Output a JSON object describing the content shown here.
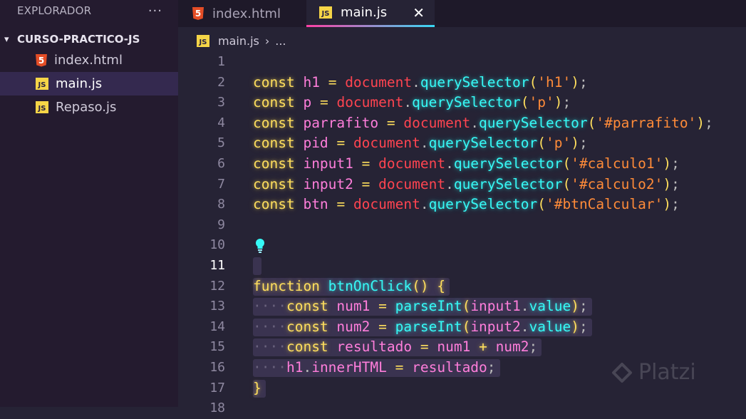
{
  "sidebar": {
    "title": "EXPLORADOR",
    "more": "···",
    "folder": "CURSO-PRACTICO-JS",
    "files": [
      {
        "name": "index.html",
        "icon": "html-file-icon"
      },
      {
        "name": "main.js",
        "icon": "js-file-icon",
        "active": true
      },
      {
        "name": "Repaso.js",
        "icon": "js-file-icon"
      }
    ]
  },
  "tabs": [
    {
      "label": "index.html",
      "icon": "html-file-icon"
    },
    {
      "label": "main.js",
      "icon": "js-file-icon",
      "active": true,
      "close": "✕"
    }
  ],
  "breadcrumb": {
    "file": "main.js",
    "sep": "›",
    "rest": "..."
  },
  "icons": {
    "html": "5",
    "js": "JS"
  },
  "editor": {
    "current_line": 11,
    "lines": [
      {
        "n": "1",
        "tokens": []
      },
      {
        "n": "2",
        "tokens": [
          [
            "k",
            "const"
          ],
          [
            "w",
            " "
          ],
          [
            "v",
            "h1"
          ],
          [
            "w",
            " "
          ],
          [
            "o",
            "="
          ],
          [
            "w",
            " "
          ],
          [
            "d",
            "document"
          ],
          [
            "p",
            "."
          ],
          [
            "f",
            "querySelector"
          ],
          [
            "o",
            "("
          ],
          [
            "s",
            "'h1'"
          ],
          [
            "o",
            ")"
          ],
          [
            "p",
            ";"
          ]
        ]
      },
      {
        "n": "3",
        "tokens": [
          [
            "k",
            "const"
          ],
          [
            "w",
            " "
          ],
          [
            "v",
            "p"
          ],
          [
            "w",
            " "
          ],
          [
            "o",
            "="
          ],
          [
            "w",
            " "
          ],
          [
            "d",
            "document"
          ],
          [
            "p",
            "."
          ],
          [
            "f",
            "querySelector"
          ],
          [
            "o",
            "("
          ],
          [
            "s",
            "'p'"
          ],
          [
            "o",
            ")"
          ],
          [
            "p",
            ";"
          ]
        ]
      },
      {
        "n": "4",
        "tokens": [
          [
            "k",
            "const"
          ],
          [
            "w",
            " "
          ],
          [
            "v",
            "parrafito"
          ],
          [
            "w",
            " "
          ],
          [
            "o",
            "="
          ],
          [
            "w",
            " "
          ],
          [
            "d",
            "document"
          ],
          [
            "p",
            "."
          ],
          [
            "f",
            "querySelector"
          ],
          [
            "o",
            "("
          ],
          [
            "s",
            "'#parrafito'"
          ],
          [
            "o",
            ")"
          ],
          [
            "p",
            ";"
          ]
        ]
      },
      {
        "n": "5",
        "tokens": [
          [
            "k",
            "const"
          ],
          [
            "w",
            " "
          ],
          [
            "v",
            "pid"
          ],
          [
            "w",
            " "
          ],
          [
            "o",
            "="
          ],
          [
            "w",
            " "
          ],
          [
            "d",
            "document"
          ],
          [
            "p",
            "."
          ],
          [
            "f",
            "querySelector"
          ],
          [
            "o",
            "("
          ],
          [
            "s",
            "'p'"
          ],
          [
            "o",
            ")"
          ],
          [
            "p",
            ";"
          ]
        ]
      },
      {
        "n": "6",
        "tokens": [
          [
            "k",
            "const"
          ],
          [
            "w",
            " "
          ],
          [
            "v",
            "input1"
          ],
          [
            "w",
            " "
          ],
          [
            "o",
            "="
          ],
          [
            "w",
            " "
          ],
          [
            "d",
            "document"
          ],
          [
            "p",
            "."
          ],
          [
            "f",
            "querySelector"
          ],
          [
            "o",
            "("
          ],
          [
            "s",
            "'#calculo1'"
          ],
          [
            "o",
            ")"
          ],
          [
            "p",
            ";"
          ]
        ]
      },
      {
        "n": "7",
        "tokens": [
          [
            "k",
            "const"
          ],
          [
            "w",
            " "
          ],
          [
            "v",
            "input2"
          ],
          [
            "w",
            " "
          ],
          [
            "o",
            "="
          ],
          [
            "w",
            " "
          ],
          [
            "d",
            "document"
          ],
          [
            "p",
            "."
          ],
          [
            "f",
            "querySelector"
          ],
          [
            "o",
            "("
          ],
          [
            "s",
            "'#calculo2'"
          ],
          [
            "o",
            ")"
          ],
          [
            "p",
            ";"
          ]
        ]
      },
      {
        "n": "8",
        "tokens": [
          [
            "k",
            "const"
          ],
          [
            "w",
            " "
          ],
          [
            "v",
            "btn"
          ],
          [
            "w",
            " "
          ],
          [
            "o",
            "="
          ],
          [
            "w",
            " "
          ],
          [
            "d",
            "document"
          ],
          [
            "p",
            "."
          ],
          [
            "f",
            "querySelector"
          ],
          [
            "o",
            "("
          ],
          [
            "s",
            "'#btnCalcular'"
          ],
          [
            "o",
            ")"
          ],
          [
            "p",
            ";"
          ]
        ]
      },
      {
        "n": "9",
        "tokens": []
      },
      {
        "n": "10",
        "tokens": [],
        "bulb": true
      },
      {
        "n": "11",
        "tokens": [],
        "selected": true
      },
      {
        "n": "12",
        "tokens": [
          [
            "k",
            "function"
          ],
          [
            "w",
            " "
          ],
          [
            "f",
            "btnOnClick"
          ],
          [
            "k",
            "()"
          ],
          [
            "w",
            " "
          ],
          [
            "k",
            "{"
          ]
        ],
        "selected": true
      },
      {
        "n": "13",
        "tokens": [
          [
            "ws",
            "····"
          ],
          [
            "k",
            "const"
          ],
          [
            "w",
            " "
          ],
          [
            "v",
            "num1"
          ],
          [
            "w",
            " "
          ],
          [
            "o",
            "="
          ],
          [
            "w",
            " "
          ],
          [
            "f",
            "parseInt"
          ],
          [
            "k",
            "("
          ],
          [
            "v",
            "input1"
          ],
          [
            "p",
            "."
          ],
          [
            "f",
            "value"
          ],
          [
            "k",
            ")"
          ],
          [
            "p",
            ";"
          ]
        ],
        "selected": true
      },
      {
        "n": "14",
        "tokens": [
          [
            "ws",
            "····"
          ],
          [
            "k",
            "const"
          ],
          [
            "w",
            " "
          ],
          [
            "v",
            "num2"
          ],
          [
            "w",
            " "
          ],
          [
            "o",
            "="
          ],
          [
            "w",
            " "
          ],
          [
            "f",
            "parseInt"
          ],
          [
            "k",
            "("
          ],
          [
            "v",
            "input2"
          ],
          [
            "p",
            "."
          ],
          [
            "f",
            "value"
          ],
          [
            "k",
            ")"
          ],
          [
            "p",
            ";"
          ]
        ],
        "selected": true
      },
      {
        "n": "15",
        "tokens": [
          [
            "ws",
            "····"
          ],
          [
            "k",
            "const"
          ],
          [
            "w",
            " "
          ],
          [
            "v",
            "resultado"
          ],
          [
            "w",
            " "
          ],
          [
            "o",
            "="
          ],
          [
            "w",
            " "
          ],
          [
            "v",
            "num1"
          ],
          [
            "w",
            " "
          ],
          [
            "k",
            "+"
          ],
          [
            "w",
            " "
          ],
          [
            "v",
            "num2"
          ],
          [
            "p",
            ";"
          ]
        ],
        "selected": true
      },
      {
        "n": "16",
        "tokens": [
          [
            "ws",
            "····"
          ],
          [
            "v",
            "h1"
          ],
          [
            "p",
            "."
          ],
          [
            "v",
            "innerHTML"
          ],
          [
            "w",
            " "
          ],
          [
            "o",
            "="
          ],
          [
            "w",
            " "
          ],
          [
            "v",
            "resultado"
          ],
          [
            "p",
            ";"
          ]
        ],
        "selected": true
      },
      {
        "n": "17",
        "tokens": [
          [
            "k",
            "}"
          ]
        ],
        "selected": true
      },
      {
        "n": "18",
        "tokens": []
      }
    ]
  },
  "watermark": "Platzi"
}
